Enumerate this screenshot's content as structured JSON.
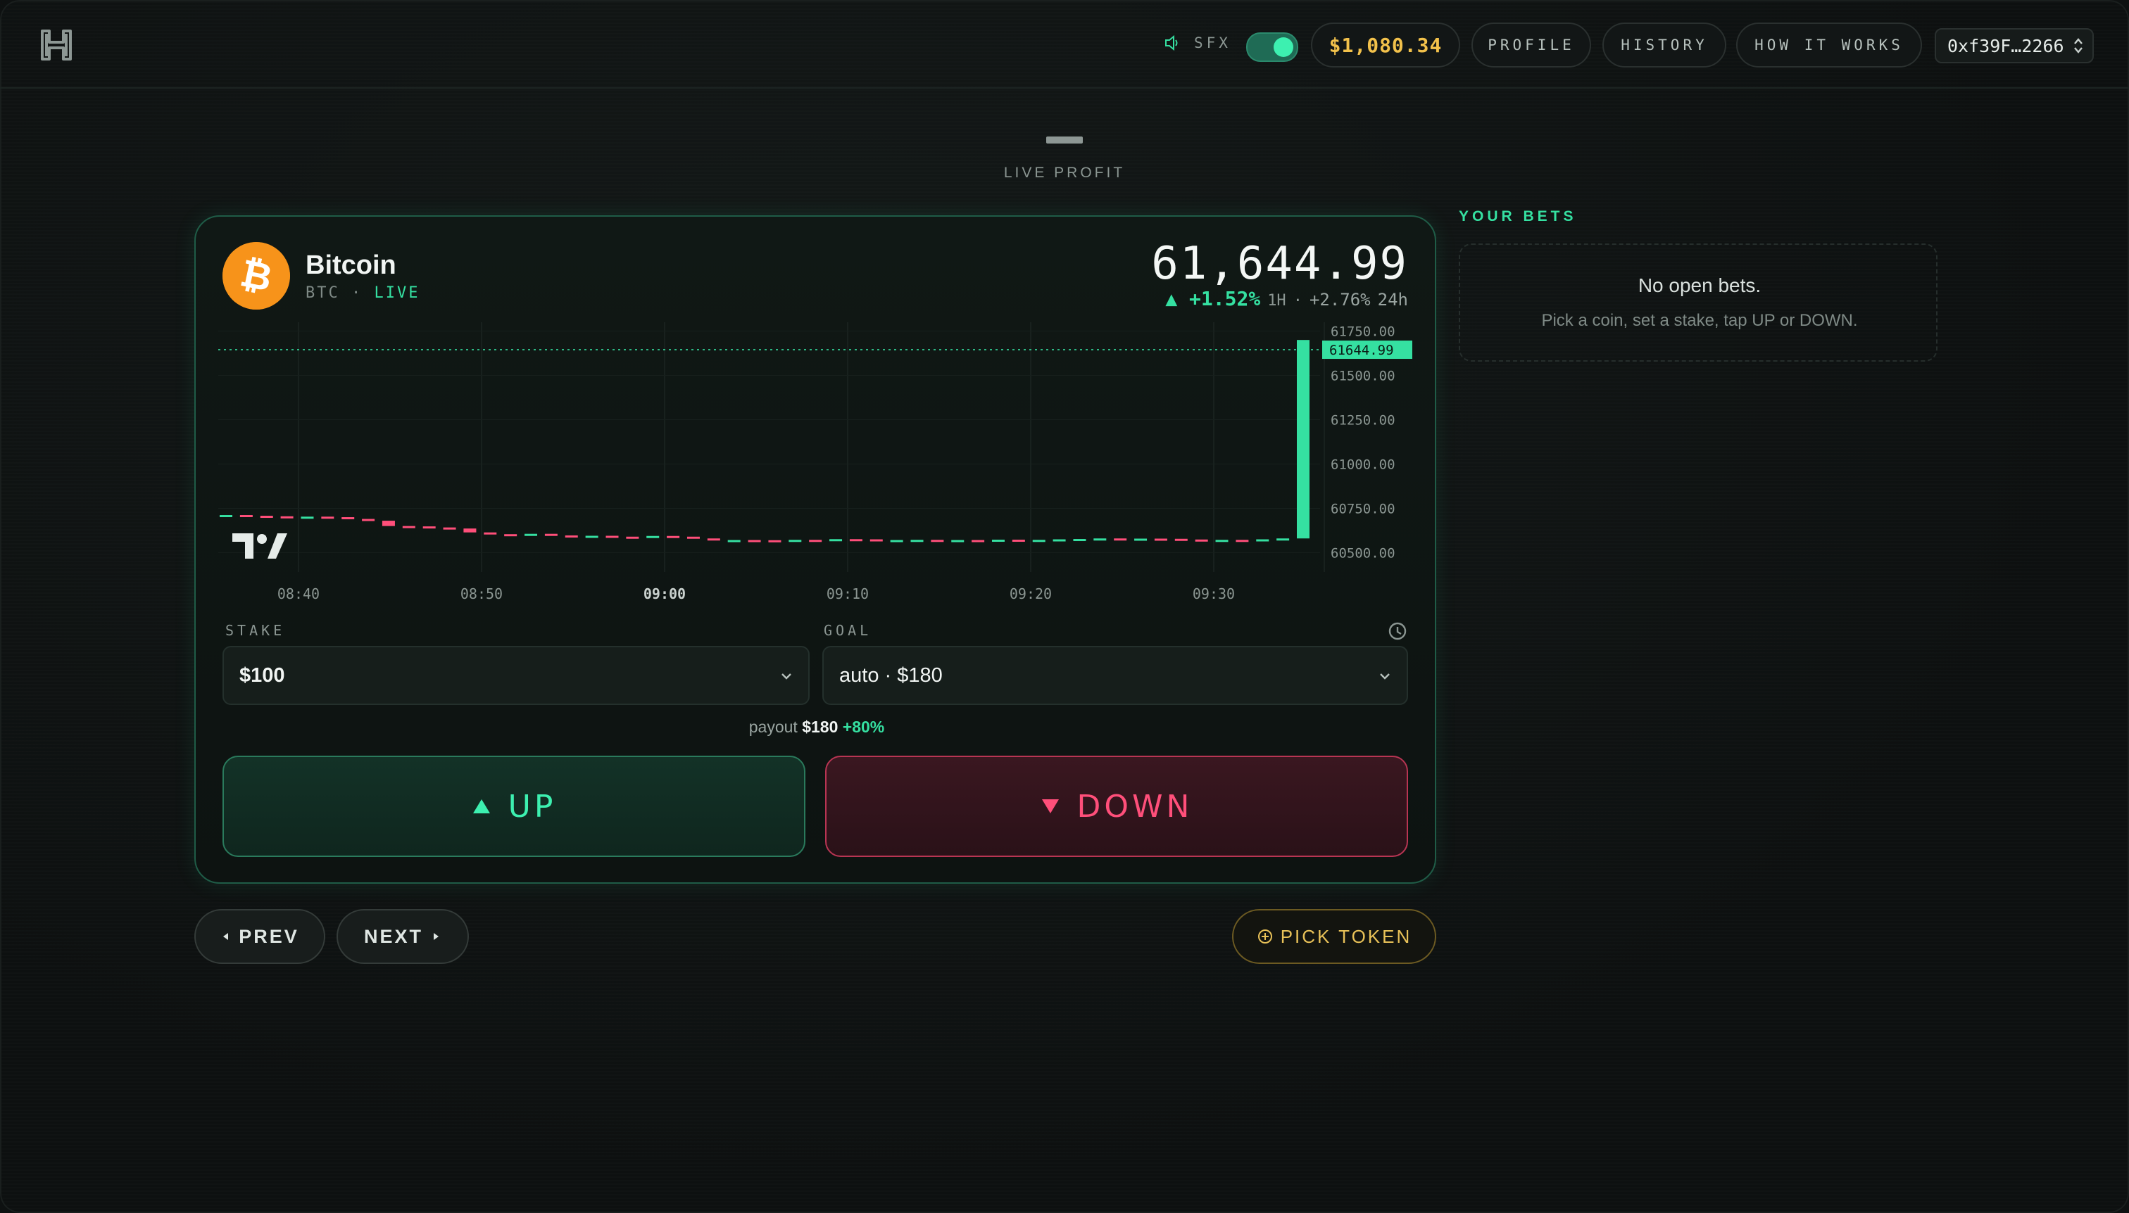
{
  "header": {
    "sfx_label": "SFX",
    "sfx_enabled": true,
    "balance": "$1,080.34",
    "nav": {
      "profile": "PROFILE",
      "history": "HISTORY",
      "how_it_works": "HOW IT WORKS"
    },
    "wallet": "0xf39F…2266"
  },
  "live_profit": {
    "label": "LIVE PROFIT"
  },
  "coin": {
    "name": "Bitcoin",
    "ticker": "BTC",
    "separator": "·",
    "status": "LIVE",
    "price": "61,644.99",
    "change_1h": "+1.52%",
    "tf_1h": "1H",
    "change_24h": "+2.76%",
    "tf_24h": "24h"
  },
  "chart_data": {
    "type": "candlestick",
    "x_ticks": [
      "08:40",
      "08:50",
      "09:00",
      "09:10",
      "09:20",
      "09:30"
    ],
    "y_ticks": [
      "61750.00",
      "61500.00",
      "61250.00",
      "61000.00",
      "60750.00",
      "60500.00"
    ],
    "ylim": [
      60450,
      61800
    ],
    "current_price_label": "61644.99",
    "current_price": 61644.99,
    "candles": [
      {
        "o": 60710,
        "c": 60712
      },
      {
        "o": 60712,
        "c": 60708
      },
      {
        "o": 60708,
        "c": 60705
      },
      {
        "o": 60705,
        "c": 60702
      },
      {
        "o": 60702,
        "c": 60703
      },
      {
        "o": 60703,
        "c": 60700
      },
      {
        "o": 60700,
        "c": 60690
      },
      {
        "o": 60690,
        "c": 60680
      },
      {
        "o": 60680,
        "c": 60650
      },
      {
        "o": 60650,
        "c": 60648
      },
      {
        "o": 60648,
        "c": 60642
      },
      {
        "o": 60642,
        "c": 60636
      },
      {
        "o": 60636,
        "c": 60614
      },
      {
        "o": 60614,
        "c": 60604
      },
      {
        "o": 60604,
        "c": 60600
      },
      {
        "o": 60600,
        "c": 60606
      },
      {
        "o": 60606,
        "c": 60597
      },
      {
        "o": 60597,
        "c": 60592
      },
      {
        "o": 60592,
        "c": 60595
      },
      {
        "o": 60595,
        "c": 60590
      },
      {
        "o": 60590,
        "c": 60589
      },
      {
        "o": 60589,
        "c": 60594
      },
      {
        "o": 60594,
        "c": 60590
      },
      {
        "o": 60590,
        "c": 60580
      },
      {
        "o": 60580,
        "c": 60570
      },
      {
        "o": 60570,
        "c": 60571
      },
      {
        "o": 60571,
        "c": 60570
      },
      {
        "o": 60570,
        "c": 60569
      },
      {
        "o": 60569,
        "c": 60572
      },
      {
        "o": 60572,
        "c": 60566
      },
      {
        "o": 60566,
        "c": 60576
      },
      {
        "o": 60576,
        "c": 60575
      },
      {
        "o": 60575,
        "c": 60570
      },
      {
        "o": 60570,
        "c": 60571
      },
      {
        "o": 60571,
        "c": 60572
      },
      {
        "o": 60572,
        "c": 60570
      },
      {
        "o": 60570,
        "c": 60571
      },
      {
        "o": 60571,
        "c": 60570
      },
      {
        "o": 60570,
        "c": 60573
      },
      {
        "o": 60573,
        "c": 60571
      },
      {
        "o": 60571,
        "c": 60572
      },
      {
        "o": 60572,
        "c": 60575
      },
      {
        "o": 60575,
        "c": 60577
      },
      {
        "o": 60577,
        "c": 60580
      },
      {
        "o": 60580,
        "c": 60577
      },
      {
        "o": 60577,
        "c": 60579
      },
      {
        "o": 60579,
        "c": 60578
      },
      {
        "o": 60578,
        "c": 60574
      },
      {
        "o": 60574,
        "c": 60570
      },
      {
        "o": 60570,
        "c": 60572
      },
      {
        "o": 60572,
        "c": 60569
      },
      {
        "o": 60569,
        "c": 60575
      },
      {
        "o": 60575,
        "c": 60580
      },
      {
        "o": 60580,
        "c": 61700
      }
    ]
  },
  "stake": {
    "label": "STAKE",
    "value": "$100"
  },
  "goal": {
    "label": "GOAL",
    "value": "auto · $180"
  },
  "payout": {
    "prefix": "payout",
    "amount": "$180",
    "bonus": "+80%"
  },
  "actions": {
    "up": "UP",
    "down": "DOWN"
  },
  "pager": {
    "prev": "PREV",
    "next": "NEXT",
    "pick": "PICK TOKEN"
  },
  "bets": {
    "title": "YOUR BETS",
    "empty": "No open bets.",
    "hint": "Pick a coin, set a stake, tap UP or DOWN."
  },
  "colors": {
    "up": "#35e0a1",
    "down": "#ff4f7a",
    "gold": "#f2c14b"
  }
}
